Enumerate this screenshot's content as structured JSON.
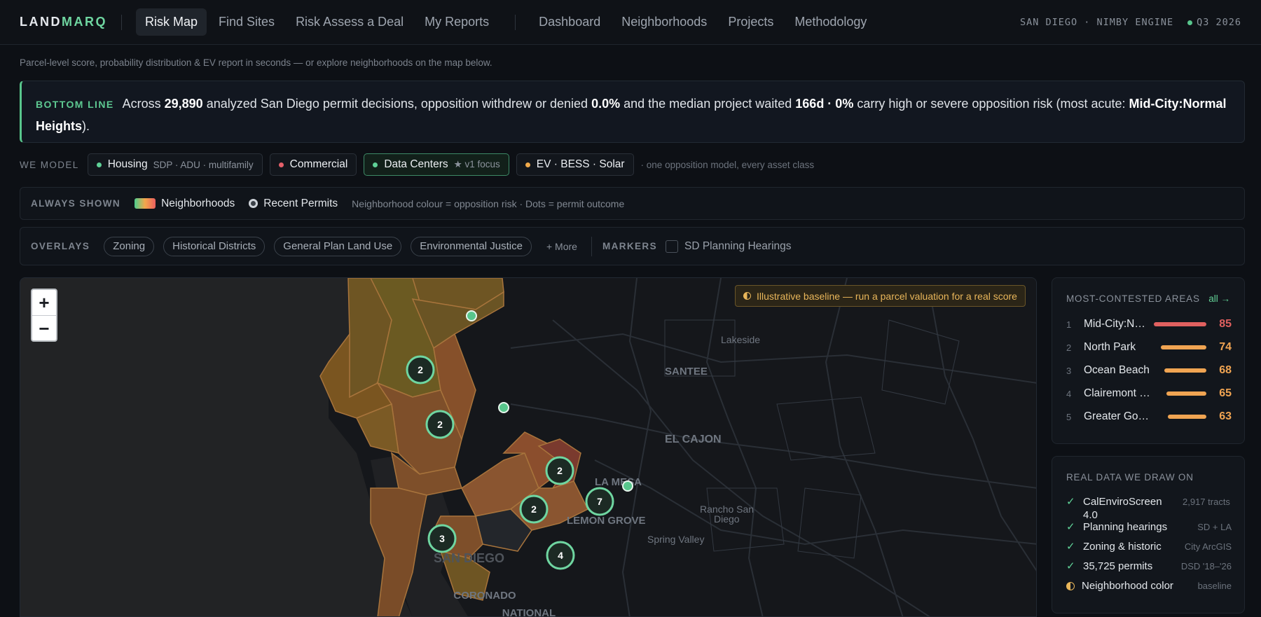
{
  "nav": {
    "logo_a": "LAND",
    "logo_b": "MARQ",
    "items": [
      "Risk Map",
      "Find Sites",
      "Risk Assess a Deal",
      "My Reports",
      "Dashboard",
      "Neighborhoods",
      "Projects",
      "Methodology"
    ],
    "context": "SAN DIEGO · NIMBY ENGINE",
    "period": "Q3 2026"
  },
  "subline": "Parcel-level score, probability distribution & EV report in seconds — or explore neighborhoods on the map below.",
  "bottom_line": {
    "tag": "BOTTOM LINE",
    "t1": "Across",
    "decisions": "29,890",
    "t2": "analyzed San Diego permit decisions, opposition withdrew or denied",
    "withdrew": "0.0%",
    "t3": "and the median project waited",
    "wait": "166d · 0%",
    "t4": "carry high or severe opposition risk (most acute:",
    "acute": "Mid-City:Normal Heights",
    "t5": ")."
  },
  "we_model": {
    "label": "WE MODEL",
    "chips": [
      {
        "label": "Housing",
        "sub": "SDP · ADU · multifamily",
        "color": "#5fd197"
      },
      {
        "label": "Commercial",
        "sub": "",
        "color": "#e5606a"
      },
      {
        "label": "Data Centers",
        "sub": "★ v1 focus",
        "color": "#5fd197"
      },
      {
        "label": "EV · BESS · Solar",
        "sub": "",
        "color": "#f0a94a"
      }
    ],
    "note": "· one opposition model, every asset class"
  },
  "always_shown": {
    "label": "ALWAYS SHOWN",
    "neighborhoods": "Neighborhoods",
    "permits": "Recent Permits",
    "note": "Neighborhood colour = opposition risk  ·  Dots = permit outcome"
  },
  "overlays": {
    "label": "OVERLAYS",
    "pills": [
      "Zoning",
      "Historical Districts",
      "General Plan Land Use",
      "Environmental Justice"
    ],
    "more": "+ More",
    "markers_label": "MARKERS",
    "marker_option": "SD Planning Hearings"
  },
  "map": {
    "zoom_in": "+",
    "zoom_out": "−",
    "baseline_note": "Illustrative baseline — run a parcel valuation for a real score",
    "place_labels": [
      "Lakeside",
      "SANTEE",
      "EL CAJON",
      "LA MESA",
      "LEMON GROVE",
      "Rancho San",
      "Diego",
      "Spring Valley",
      "SAN DIEGO",
      "CORONADO",
      "NATIONAL"
    ],
    "clusters": [
      "2",
      "2",
      "2",
      "2",
      "7",
      "3",
      "4"
    ]
  },
  "contested": {
    "title": "MOST-CONTESTED AREAS",
    "all_link": "all →",
    "rows": [
      {
        "rank": "1",
        "name": "Mid-City:Normal Heights",
        "score": 85,
        "color": "#e0605f"
      },
      {
        "rank": "2",
        "name": "North Park",
        "score": 74,
        "color": "#f0a452"
      },
      {
        "rank": "3",
        "name": "Ocean Beach",
        "score": 68,
        "color": "#f0a452"
      },
      {
        "rank": "4",
        "name": "Clairemont Mesa",
        "score": 65,
        "color": "#f0a452"
      },
      {
        "rank": "5",
        "name": "Greater Golden Hill",
        "score": 63,
        "color": "#f0a452"
      }
    ]
  },
  "sources": {
    "title": "REAL DATA WE DRAW ON",
    "rows": [
      {
        "name": "CalEnviroScreen 4.0",
        "meta": "2,917 tracts",
        "icon": "check-icon"
      },
      {
        "name": "Planning hearings",
        "meta": "SD + LA",
        "icon": "check-icon"
      },
      {
        "name": "Zoning & historic",
        "meta": "City ArcGIS",
        "icon": "check-icon"
      },
      {
        "name": "35,725 permits",
        "meta": "DSD '18–'26",
        "icon": "check-icon"
      },
      {
        "name": "Neighborhood color",
        "meta": "baseline",
        "icon": "half-circle-icon"
      }
    ]
  }
}
